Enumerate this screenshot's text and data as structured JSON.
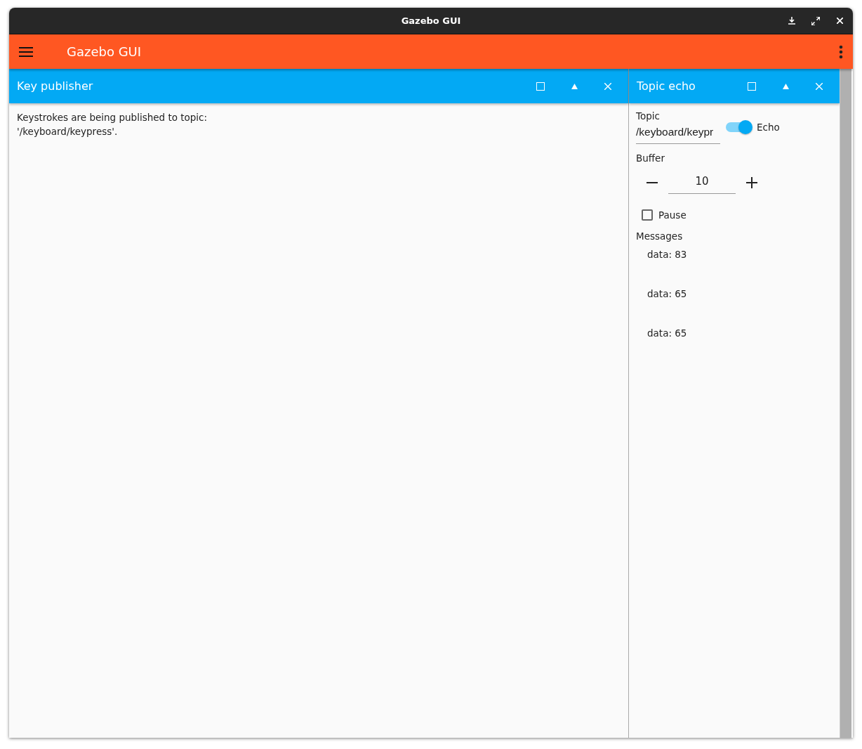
{
  "window": {
    "title": "Gazebo GUI"
  },
  "app_bar": {
    "title": "Gazebo GUI"
  },
  "panels": [
    {
      "kind": "key_publisher",
      "title": "Key publisher",
      "text": "Keystrokes are being published to topic:\n'/keyboard/keypress'."
    },
    {
      "kind": "topic_echo",
      "title": "Topic echo",
      "topic_label": "Topic",
      "topic_value": "/keyboard/keypr",
      "echo": {
        "label": "Echo",
        "on": true
      },
      "buffer_label": "Buffer",
      "buffer_value": "10",
      "pause": {
        "label": "Pause",
        "checked": false
      },
      "messages_label": "Messages",
      "messages": [
        "data: 83",
        "data: 65",
        "data: 65"
      ]
    }
  ]
}
